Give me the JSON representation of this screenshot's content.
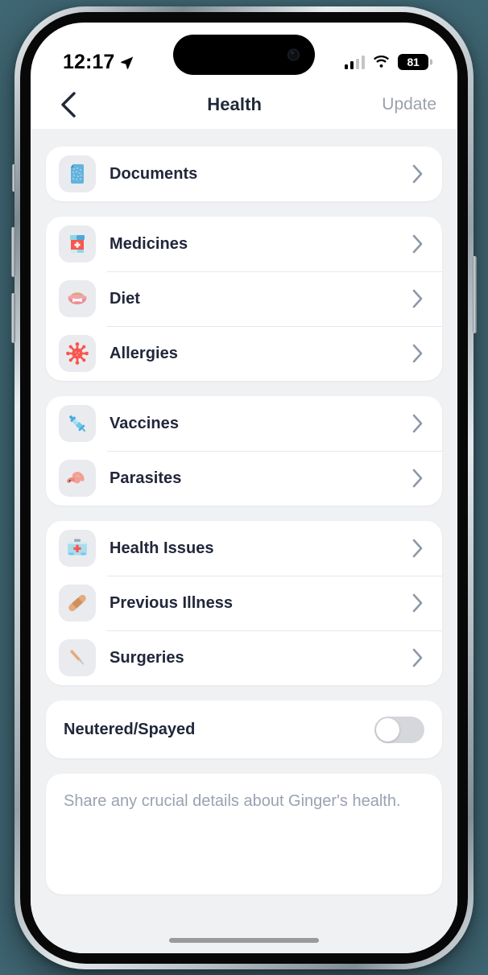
{
  "statusbar": {
    "time": "12:17",
    "location_icon": "location-arrow-icon",
    "signal_icon": "cellular-signal-icon",
    "wifi_icon": "wifi-icon",
    "battery_level": "81"
  },
  "navbar": {
    "back_icon": "chevron-left-icon",
    "title": "Health",
    "action_label": "Update"
  },
  "groups": [
    {
      "name": "documents-group",
      "rows": [
        {
          "label": "Documents",
          "icon": "document-file-icon",
          "chevron": "chevron-right-icon"
        }
      ]
    },
    {
      "name": "medical-group",
      "rows": [
        {
          "label": "Medicines",
          "icon": "pill-bottle-icon",
          "chevron": "chevron-right-icon"
        },
        {
          "label": "Diet",
          "icon": "pet-food-bowl-icon",
          "chevron": "chevron-right-icon"
        },
        {
          "label": "Allergies",
          "icon": "allergen-virus-icon",
          "chevron": "chevron-right-icon"
        }
      ]
    },
    {
      "name": "prevention-group",
      "rows": [
        {
          "label": "Vaccines",
          "icon": "syringe-icon",
          "chevron": "chevron-right-icon"
        },
        {
          "label": "Parasites",
          "icon": "worm-icon",
          "chevron": "chevron-right-icon"
        }
      ]
    },
    {
      "name": "conditions-group",
      "rows": [
        {
          "label": "Health Issues",
          "icon": "first-aid-kit-icon",
          "chevron": "chevron-right-icon"
        },
        {
          "label": "Previous Illness",
          "icon": "bandage-icon",
          "chevron": "chevron-right-icon"
        },
        {
          "label": "Surgeries",
          "icon": "scalpel-icon",
          "chevron": "chevron-right-icon"
        }
      ]
    }
  ],
  "neutered": {
    "label": "Neutered/Spayed",
    "enabled": false
  },
  "notes": {
    "placeholder": "Share any crucial details about Ginger's health.",
    "value": ""
  },
  "colors": {
    "page_background": "#f0f1f3",
    "card": "#ffffff",
    "text_primary": "#21273a",
    "text_muted": "#9aa2b1",
    "chevron": "#8d98a8",
    "icon_tile": "#eaebef",
    "accent_red": "#f8564f",
    "accent_blue": "#5bb4df",
    "outer_background": "#3f6673"
  }
}
